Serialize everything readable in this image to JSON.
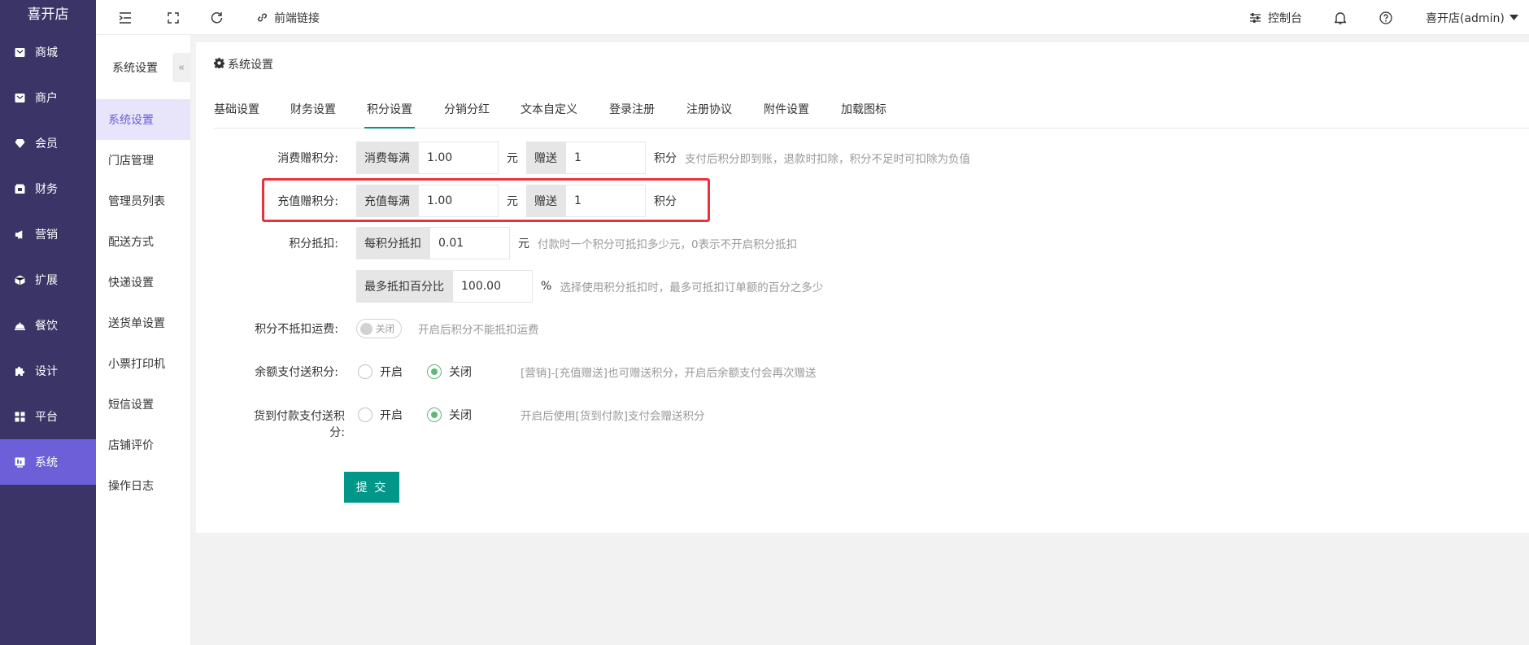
{
  "app": {
    "logo": "喜开店"
  },
  "sidebar": {
    "items": [
      {
        "label": "商城",
        "icon": "mall-icon",
        "active": false
      },
      {
        "label": "商户",
        "icon": "merchant-icon",
        "active": false
      },
      {
        "label": "会员",
        "icon": "member-icon",
        "active": false
      },
      {
        "label": "财务",
        "icon": "finance-icon",
        "active": false
      },
      {
        "label": "营销",
        "icon": "megaphone-icon",
        "active": false
      },
      {
        "label": "扩展",
        "icon": "cube-icon",
        "active": false
      },
      {
        "label": "餐饮",
        "icon": "dining-icon",
        "active": false
      },
      {
        "label": "设计",
        "icon": "puzzle-icon",
        "active": false
      },
      {
        "label": "平台",
        "icon": "grid-icon",
        "active": false
      },
      {
        "label": "系统",
        "icon": "system-icon",
        "active": true
      }
    ]
  },
  "topbar": {
    "frontend_link": "前端链接",
    "console": "控制台",
    "user": "喜开店(admin)"
  },
  "subnav": {
    "title": "系统设置",
    "collapse": "«",
    "items": [
      "系统设置",
      "门店管理",
      "管理员列表",
      "配送方式",
      "快递设置",
      "送货单设置",
      "小票打印机",
      "短信设置",
      "店铺评价",
      "操作日志"
    ],
    "active_index": 0
  },
  "card": {
    "title": "系统设置"
  },
  "tabs": [
    "基础设置",
    "财务设置",
    "积分设置",
    "分销分红",
    "文本自定义",
    "登录注册",
    "注册协议",
    "附件设置",
    "加载图标"
  ],
  "active_tab": "积分设置",
  "form": {
    "consume": {
      "label": "消费赠积分:",
      "prefix": "消费每满",
      "amount": "1.00",
      "unit_yuan": "元",
      "give_label": "赠送",
      "points": "1",
      "unit_points": "积分",
      "tip": "支付后积分即到账，退款时扣除，积分不足时可扣除为负值"
    },
    "recharge": {
      "label": "充值赠积分:",
      "prefix": "充值每满",
      "amount": "1.00",
      "unit_yuan": "元",
      "give_label": "赠送",
      "points": "1",
      "unit_points": "积分"
    },
    "deduct": {
      "label": "积分抵扣:",
      "prefix": "每积分抵扣",
      "value": "0.01",
      "unit": "元",
      "tip": "付款时一个积分可抵扣多少元，0表示不开启积分抵扣"
    },
    "max_percent": {
      "prefix": "最多抵扣百分比",
      "value": "100.00",
      "unit": "%",
      "tip": "选择使用积分抵扣时，最多可抵扣订单额的百分之多少"
    },
    "no_freight": {
      "label": "积分不抵扣运费:",
      "switch_text": "关闭",
      "on": false,
      "tip": "开启后积分不能抵扣运费"
    },
    "balance_pay": {
      "label": "余额支付送积分:",
      "opt_on": "开启",
      "opt_off": "关闭",
      "selected": "关闭",
      "tip": "[营销]-[充值赠送]也可赠送积分，开启后余额支付会再次赠送"
    },
    "cod_pay": {
      "label_line1": "货到付款支付送积",
      "label_line2": "分:",
      "opt_on": "开启",
      "opt_off": "关闭",
      "selected": "关闭",
      "tip": "开启后使用[货到付款]支付会赠送积分"
    },
    "submit": "提 交"
  },
  "colors": {
    "sidebar": "#3b3466",
    "sidebar_active": "#6c5fd8",
    "primary": "#009688",
    "highlight": "#e9323a",
    "radio_on": "#5fb878"
  }
}
